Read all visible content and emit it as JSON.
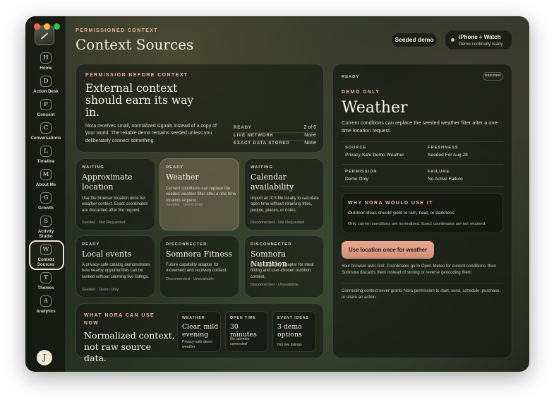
{
  "header": {
    "eyebrow": "PERMISSIONED CONTEXT",
    "title": "Context Sources",
    "seeded_pill": "Seeded demo",
    "device": {
      "title": "iPhone + Watch",
      "subtitle": "Demo continuity ready"
    }
  },
  "sidebar": {
    "items": [
      {
        "badge": "H",
        "label": "Home"
      },
      {
        "badge": "D",
        "label": "Action Desk"
      },
      {
        "badge": "P",
        "label": "Consent"
      },
      {
        "badge": "C",
        "label": "Conversations"
      },
      {
        "badge": "L",
        "label": "Timeline"
      },
      {
        "badge": "M",
        "label": "About Me"
      },
      {
        "badge": "G",
        "label": "Growth"
      },
      {
        "badge": "S",
        "label": "Activity Studio"
      },
      {
        "badge": "W",
        "label": "Context Sources"
      },
      {
        "badge": "T",
        "label": "Themes"
      },
      {
        "badge": "A",
        "label": "Analytics"
      }
    ],
    "avatar": "J"
  },
  "hero": {
    "eyebrow": "PERMISSION BEFORE CONTEXT",
    "title": "External context should earn its way in.",
    "body": "Nora receives small, normalized signals instead of a copy of your world. The reliable demo remains seeded unless you deliberately connect something.",
    "stats": [
      {
        "label": "READY",
        "value": "2 of 6"
      },
      {
        "label": "LIVE NETWORK",
        "value": "None"
      },
      {
        "label": "EXACT DATA STORED",
        "value": "None"
      }
    ]
  },
  "sources": [
    {
      "status": "WAITING",
      "title": "Approximate location",
      "desc": "Use the browser location once for weather context. Exact coordinates are discarded after the request.",
      "foot": "Seeded · Not Requested"
    },
    {
      "status": "READY",
      "title": "Weather",
      "desc": "Current conditions can replace the seeded weather filter after a one-time location request.",
      "foot": "Seeded · Demo Only"
    },
    {
      "status": "WAITING",
      "title": "Calendar availability",
      "desc": "Import an ICS file locally to calculate open time without retaining titles, people, places, or notes.",
      "foot": "Disconnected · Not Requested"
    },
    {
      "status": "READY",
      "title": "Local events",
      "desc": "A privacy-safe catalog demonstrates how nearby opportunities can be ranked without claiming live listings.",
      "foot": "Seeded · Demo Only"
    },
    {
      "status": "DISCONNECTED",
      "title": "Somnora Fitness",
      "desc": "Future capability adapter for movement and recovery context.",
      "foot": "Disconnected · Unavailable"
    },
    {
      "status": "DISCONNECTED",
      "title": "Somnora Nutrition",
      "desc": "Future capability adapter for meal timing and user-chosen nutrition context.",
      "foot": "Disconnected · Unavailable"
    }
  ],
  "usage": {
    "eyebrow": "WHAT NORA CAN USE NOW",
    "title": "Normalized context, not raw source data.",
    "cards": [
      {
        "label": "WEATHER",
        "value": "Clear, mild evening",
        "note": "Privacy-safe demo weather"
      },
      {
        "label": "OPEN TIME",
        "value": "30 minutes",
        "note": "No calendar connected"
      },
      {
        "label": "EVENT IDEAS",
        "value": "3 demo options",
        "note": "Not live listings"
      }
    ]
  },
  "detail": {
    "status": "READY",
    "badge": "SEEDED",
    "eyebrow": "DEMO ONLY",
    "title": "Weather",
    "body": "Current conditions can replace the seeded weather filter after a one-time location request.",
    "fields": [
      {
        "label": "SOURCE",
        "value": "Privacy-Safe Demo Weather"
      },
      {
        "label": "FRESHNESS",
        "value": "Seeded For Aug 28"
      },
      {
        "label": "PERMISSION",
        "value": "Demo Only"
      },
      {
        "label": "FAILURE",
        "value": "No Active Failure"
      }
    ],
    "why": {
      "eyebrow": "WHY NORA WOULD USE IT",
      "p1": "Outdoor ideas should yield to rain, heat, or darkness.",
      "p2": "Only current conditions are normalized. Exact coordinates are not retained."
    },
    "cta": "Use location once for weather",
    "note1": "Your browser asks first. Coordinates go to Open-Meteo for current conditions, then Somnora discards them instead of storing or reverse geocoding them.",
    "note2": "Connecting context never grants Nora permission to start, send, schedule, purchase, or share an action."
  },
  "colors": {
    "accent": "#e3b79a",
    "cta": "#e0a08a",
    "light_red": "#ff5f57",
    "light_yellow": "#febc2e",
    "light_green": "#28c840"
  }
}
